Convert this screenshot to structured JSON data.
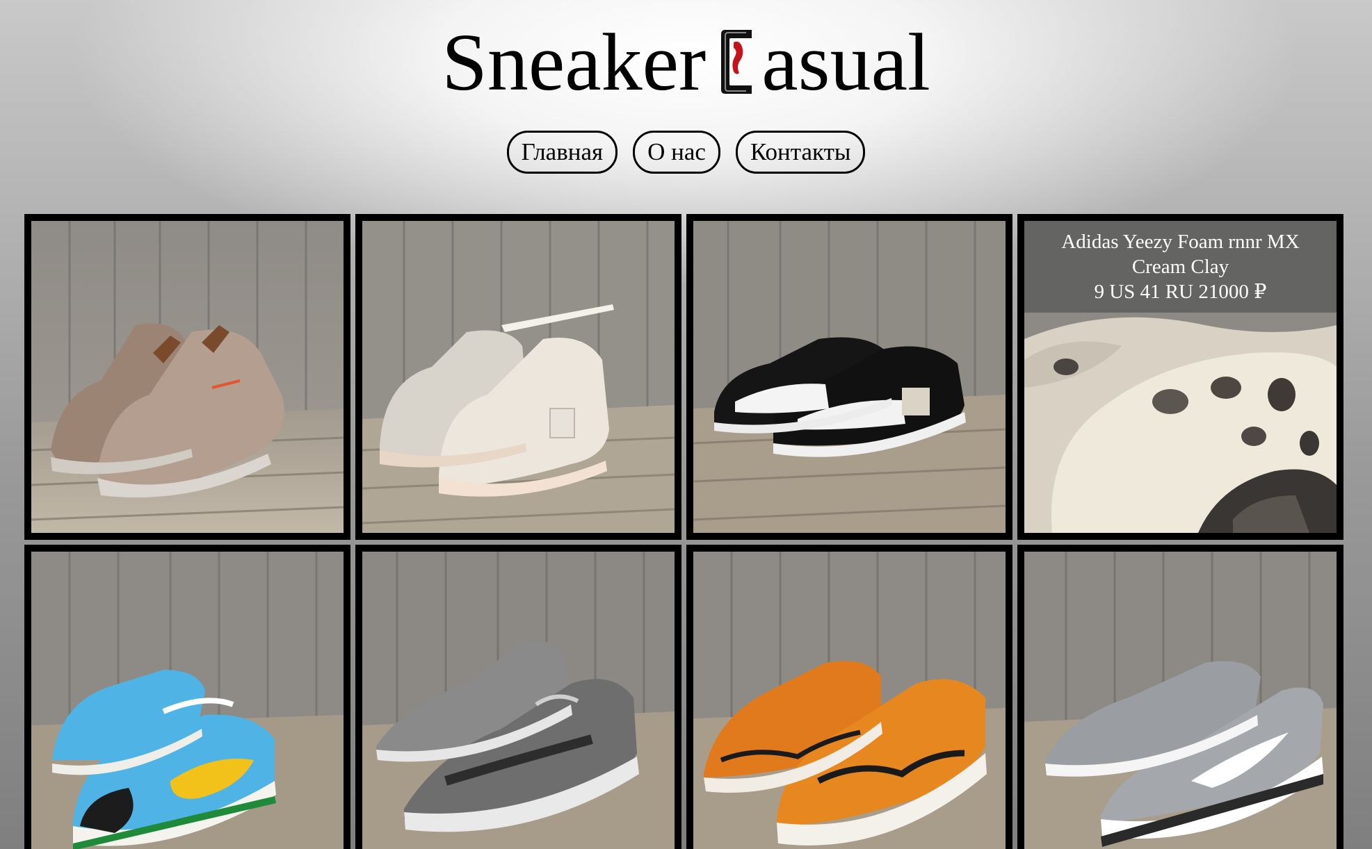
{
  "brand": {
    "title_left": "Sneaker",
    "title_right": "asual",
    "mark_icon": "sneaker-c-logo-icon"
  },
  "nav": {
    "items": [
      {
        "label": "Главная"
      },
      {
        "label": "О нас"
      },
      {
        "label": "Контакты"
      }
    ]
  },
  "products": [
    {
      "image": "tan-suede-high-top-sneakers",
      "colors": {
        "main": "#a88f80",
        "accent": "#7a4a2c"
      }
    },
    {
      "image": "cream-sail-high-top-sneakers",
      "colors": {
        "main": "#ece3d7",
        "accent": "#bdb7ad"
      }
    },
    {
      "image": "black-white-low-top-sneakers",
      "colors": {
        "main": "#141414",
        "accent": "#f4f4f4"
      }
    },
    {
      "image": "cream-clay-foam-runner",
      "caption": {
        "name": "Adidas Yeezy Foam rnnr MX",
        "name2": "Cream Clay",
        "details": "9 US 41 RU 21000 ₽"
      },
      "colors": {
        "main": "#efe9dc",
        "accent": "#3a3633"
      }
    },
    {
      "image": "blue-yellow-cow-print-low-top-sneakers",
      "colors": {
        "main": "#4fb3e6",
        "accent": "#f2c21a"
      }
    },
    {
      "image": "grey-knit-sneakers",
      "colors": {
        "main": "#6e6e6e",
        "accent": "#e9e9e9"
      }
    },
    {
      "image": "orange-skeleton-low-top-sneakers",
      "colors": {
        "main": "#e07a1c",
        "accent": "#f4f1ea"
      }
    },
    {
      "image": "grey-suede-runner-sneakers",
      "colors": {
        "main": "#a4a7ab",
        "accent": "#ffffff"
      }
    }
  ]
}
